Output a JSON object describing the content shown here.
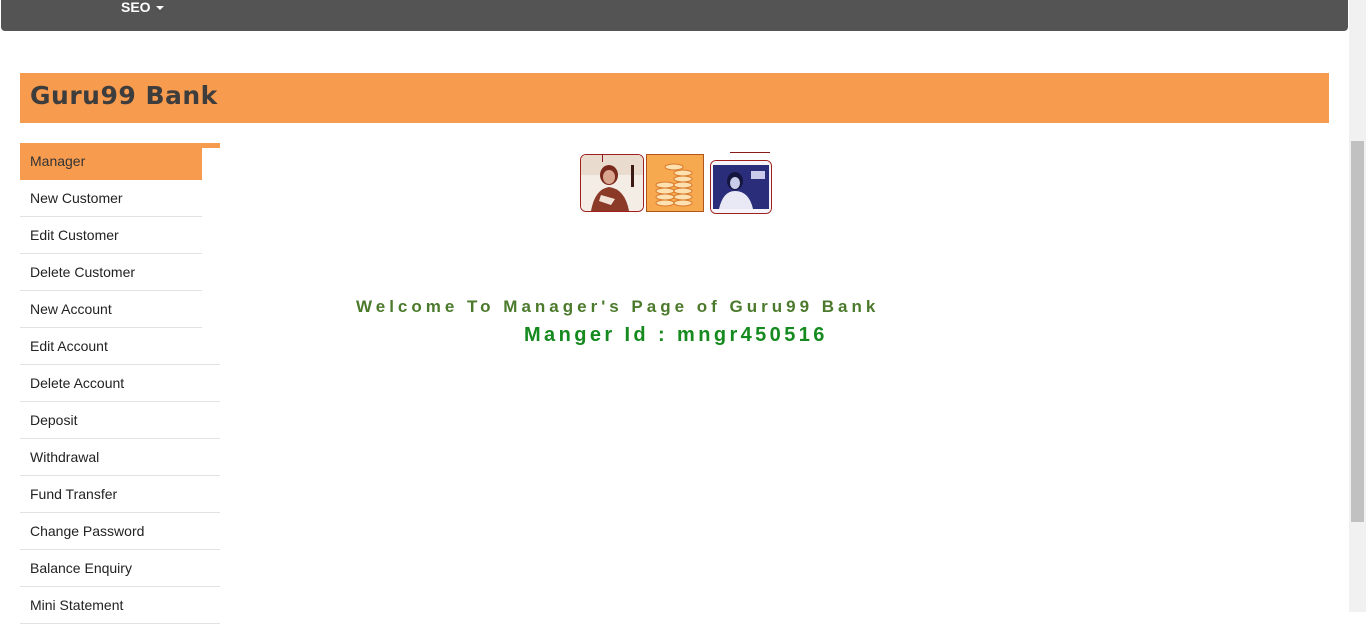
{
  "navbar": {
    "seo_label": "SEO"
  },
  "brand": {
    "title": "Guru99 Bank"
  },
  "menu": {
    "items": [
      {
        "label": "Manager"
      },
      {
        "label": "New Customer"
      },
      {
        "label": "Edit Customer"
      },
      {
        "label": "Delete Customer"
      },
      {
        "label": "New Account"
      },
      {
        "label": "Edit Account"
      },
      {
        "label": "Delete Account"
      },
      {
        "label": "Deposit"
      },
      {
        "label": "Withdrawal"
      },
      {
        "label": "Fund Transfer"
      },
      {
        "label": "Change Password"
      },
      {
        "label": "Balance Enquiry"
      },
      {
        "label": "Mini Statement"
      }
    ]
  },
  "main": {
    "welcome_text": "Welcome To Manager's Page of Guru99 Bank",
    "manager_id_text": "Manger Id : mngr450516"
  },
  "colors": {
    "accent": "#f79b4f",
    "navbar": "#545454",
    "welcome_green": "#4c7a2c",
    "id_green": "#158a1e"
  }
}
